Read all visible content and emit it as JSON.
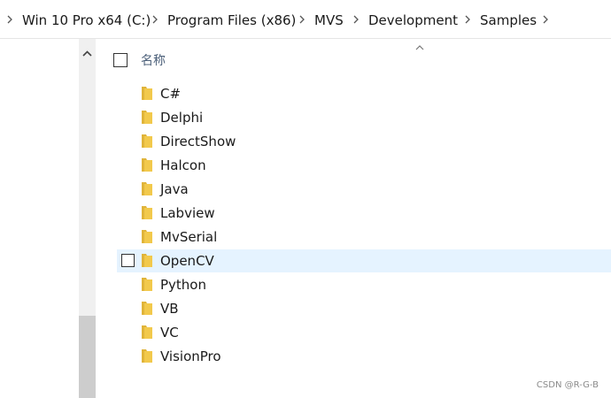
{
  "breadcrumb": [
    "Win 10 Pro x64 (C:)",
    "Program Files (x86)",
    "MVS",
    "Development",
    "Samples"
  ],
  "column_header": {
    "name": "名称"
  },
  "files": [
    {
      "name": "C#",
      "selected": false
    },
    {
      "name": "Delphi",
      "selected": false
    },
    {
      "name": "DirectShow",
      "selected": false
    },
    {
      "name": "Halcon",
      "selected": false
    },
    {
      "name": "Java",
      "selected": false
    },
    {
      "name": "Labview",
      "selected": false
    },
    {
      "name": "MvSerial",
      "selected": false
    },
    {
      "name": "OpenCV",
      "selected": true
    },
    {
      "name": "Python",
      "selected": false
    },
    {
      "name": "VB",
      "selected": false
    },
    {
      "name": "VC",
      "selected": false
    },
    {
      "name": "VisionPro",
      "selected": false
    }
  ],
  "watermark": "CSDN @R-G-B",
  "colors": {
    "folder": "#f2c94c",
    "selected_row": "#e5f3ff",
    "header_text": "#4c607a"
  },
  "icons": {
    "separator": "chevron-right-icon",
    "folder": "folder-icon",
    "sort": "chevron-up-icon",
    "scroll_up": "scroll-up-arrow-icon"
  }
}
